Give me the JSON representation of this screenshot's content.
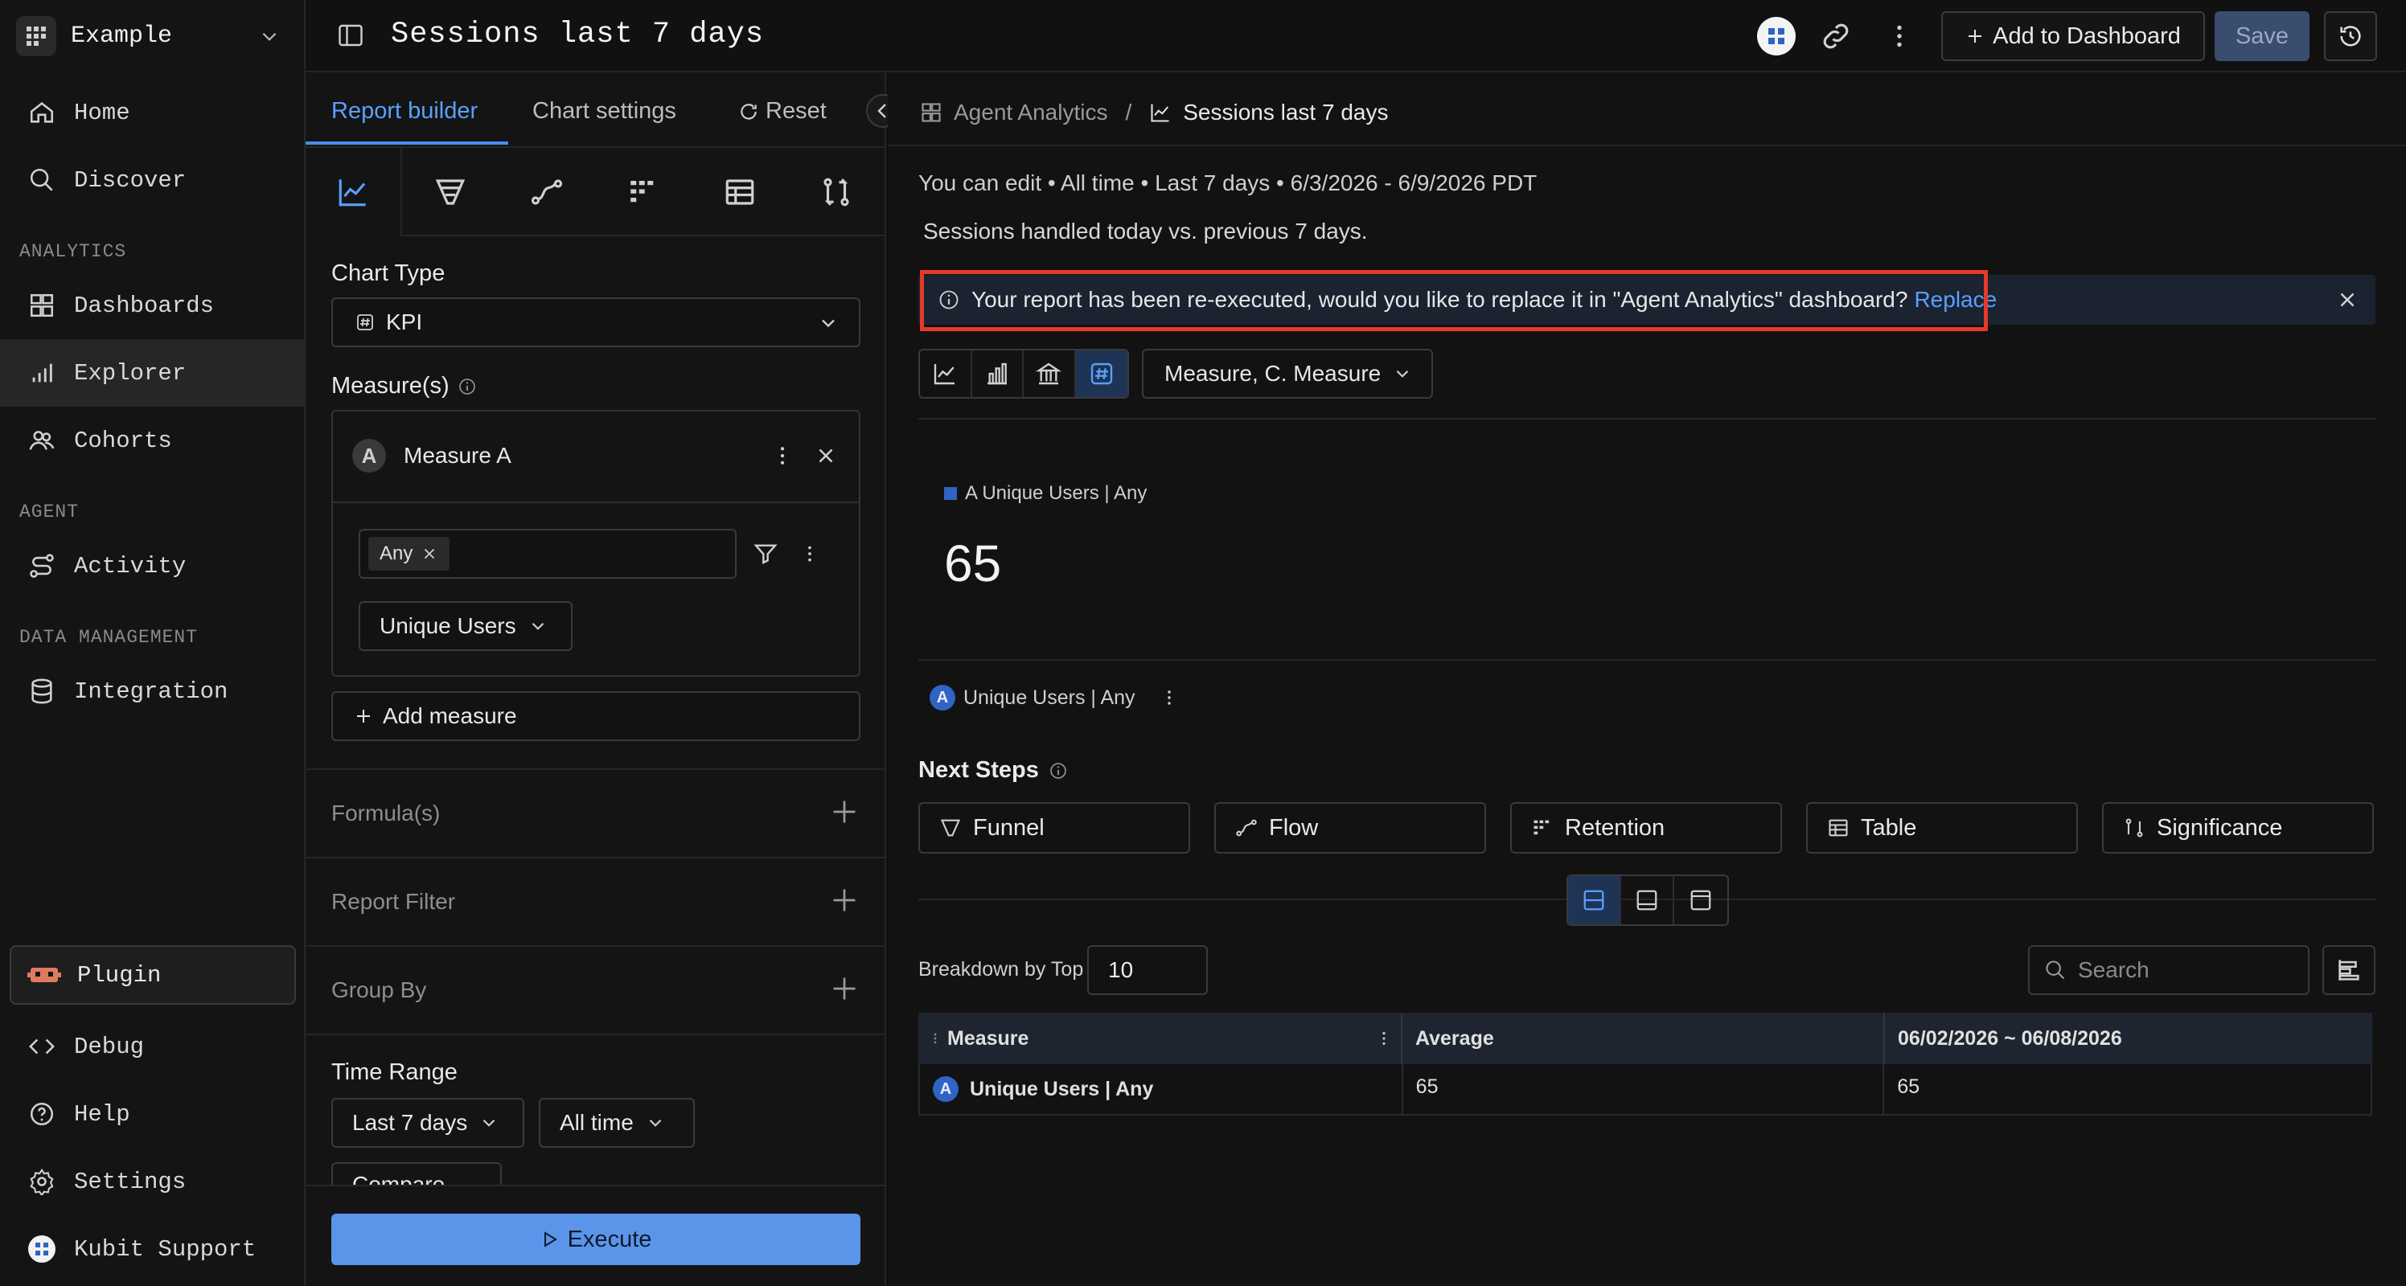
{
  "workspace": {
    "name": "Example"
  },
  "sidebar": {
    "items": [
      {
        "label": "Home"
      },
      {
        "label": "Discover"
      },
      {
        "label": "Dashboards"
      },
      {
        "label": "Explorer"
      },
      {
        "label": "Cohorts"
      },
      {
        "label": "Activity"
      },
      {
        "label": "Integration"
      },
      {
        "label": "Plugin"
      },
      {
        "label": "Debug"
      },
      {
        "label": "Help"
      },
      {
        "label": "Settings"
      },
      {
        "label": "Kubit Support"
      }
    ],
    "sections": {
      "analytics": "ANALYTICS",
      "agent": "AGENT",
      "data_management": "DATA MANAGEMENT"
    }
  },
  "header": {
    "title": "Sessions last 7 days",
    "add_to_dashboard": "Add to Dashboard",
    "save": "Save"
  },
  "builder": {
    "tabs": {
      "report_builder": "Report builder",
      "chart_settings": "Chart settings",
      "reset": "Reset"
    },
    "chart_type_label": "Chart Type",
    "chart_type_value": "KPI",
    "measures_label": "Measure(s)",
    "measure_name": "Measure A",
    "measure_badge": "A",
    "filter_chip": "Any",
    "aggregation": "Unique Users",
    "add_measure": "Add measure",
    "formulas": "Formula(s)",
    "report_filter": "Report Filter",
    "group_by": "Group By",
    "time_range_label": "Time Range",
    "time_range_value": "Last 7 days",
    "time_scope": "All time",
    "compare": "Compare",
    "execute": "Execute"
  },
  "main": {
    "breadcrumb": {
      "parent": "Agent Analytics",
      "sep": "/",
      "current": "Sessions last 7 days"
    },
    "meta": "You can edit • All time • Last 7 days • 6/3/2026 - 6/9/2026 PDT",
    "description": "Sessions handled today vs. previous 7 days.",
    "banner": {
      "text": "Your report has been re-executed, would you like to replace it in \"Agent Analytics\" dashboard?",
      "action": "Replace"
    },
    "measure_select": "Measure, C. Measure",
    "kpi": {
      "legend": "A Unique Users | Any",
      "value": "65"
    },
    "series_label": "Unique Users | Any",
    "series_badge": "A",
    "next_steps": {
      "title": "Next Steps",
      "items": [
        {
          "label": "Funnel"
        },
        {
          "label": "Flow"
        },
        {
          "label": "Retention"
        },
        {
          "label": "Table"
        },
        {
          "label": "Significance"
        }
      ]
    },
    "breakdown": {
      "label": "Breakdown by Top",
      "value": "10"
    },
    "search": {
      "placeholder": "Search"
    },
    "table": {
      "headers": [
        "Measure",
        "Average",
        "06/02/2026 ~ 06/08/2026"
      ],
      "rows": [
        {
          "badge": "A",
          "measure": "Unique Users | Any",
          "average": "65",
          "period": "65"
        }
      ]
    }
  },
  "colors": {
    "accent": "#4a8cf0",
    "highlight": "#e53a2a",
    "execute": "#5b95ea"
  }
}
